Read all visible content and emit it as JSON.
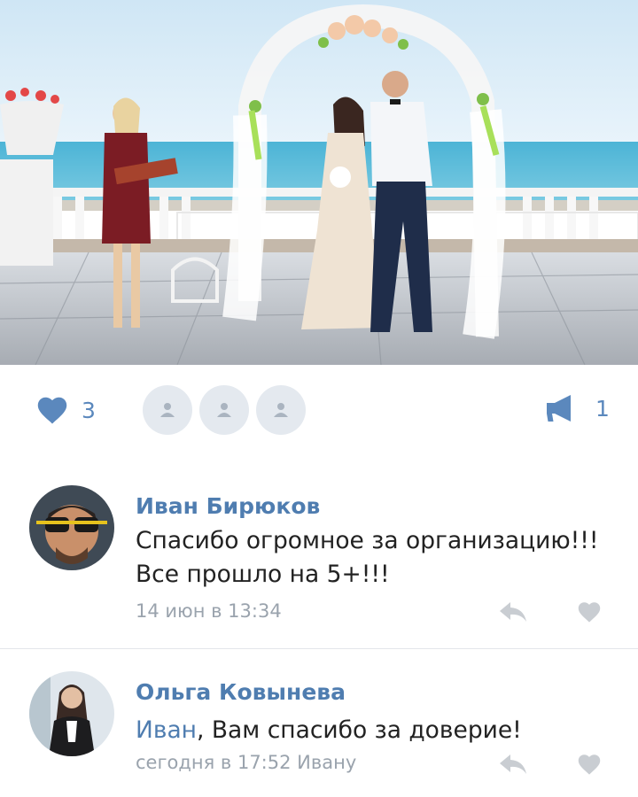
{
  "post": {
    "photo_icon": "wedding-photo",
    "likes_count": "3",
    "shares_count": "1"
  },
  "comments": [
    {
      "author": "Иван Бирюков",
      "text": "Спасибо огромное за организацию!!! Все прошло на 5+!!!",
      "timestamp": "14 июн в 13:34"
    },
    {
      "author": "Ольга Ковынева",
      "reply_name": "Иван",
      "text": ", Вам спасибо за доверие!",
      "timestamp": "сегодня в 17:52 Ивану"
    }
  ],
  "colors": {
    "accent": "#5b88bd",
    "author": "#4f7db0",
    "meta": "#9aa3ad",
    "icon_gray": "#c9cdd2"
  },
  "icons": [
    "heart-icon",
    "user-icon",
    "megaphone-icon",
    "reply-icon"
  ]
}
